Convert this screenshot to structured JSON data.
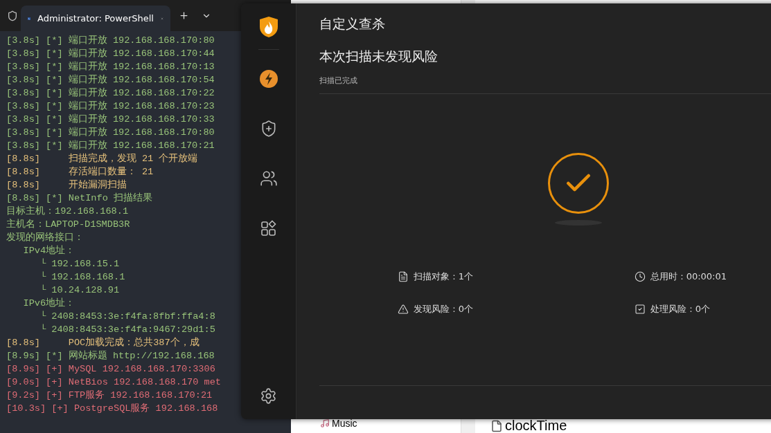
{
  "terminal": {
    "tab_title": "Administrator: PowerShell",
    "lines": [
      {
        "kind": "info",
        "text": "[3.8s] [*] 端口开放 192.168.168.170:80"
      },
      {
        "kind": "info",
        "text": "[3.8s] [*] 端口开放 192.168.168.170:44"
      },
      {
        "kind": "info",
        "text": "[3.8s] [*] 端口开放 192.168.168.170:13"
      },
      {
        "kind": "info",
        "text": "[3.8s] [*] 端口开放 192.168.168.170:54"
      },
      {
        "kind": "info",
        "text": "[3.8s] [*] 端口开放 192.168.168.170:22"
      },
      {
        "kind": "info",
        "text": "[3.8s] [*] 端口开放 192.168.168.170:23"
      },
      {
        "kind": "info",
        "text": "[3.8s] [*] 端口开放 192.168.168.170:33"
      },
      {
        "kind": "info",
        "text": "[3.8s] [*] 端口开放 192.168.168.170:80"
      },
      {
        "kind": "info",
        "text": "[3.8s] [*] 端口开放 192.168.168.170:21"
      },
      {
        "kind": "status",
        "text": "[8.8s]     扫描完成，发现 21 个开放端"
      },
      {
        "kind": "status",
        "text": "[8.8s]     存活端口数量： 21"
      },
      {
        "kind": "status",
        "text": "[8.8s]     开始漏洞扫描"
      },
      {
        "kind": "info",
        "text": "[8.8s] [*] NetInfo 扫描结果"
      },
      {
        "kind": "info",
        "text": "目标主机：192.168.168.1"
      },
      {
        "kind": "info",
        "text": "主机名：LAPTOP-D1SMDB3R"
      },
      {
        "kind": "info",
        "text": "发现的网络接口："
      },
      {
        "kind": "info",
        "text": "   IPv4地址："
      },
      {
        "kind": "info",
        "text": "      └ 192.168.15.1"
      },
      {
        "kind": "info",
        "text": "      └ 192.168.168.1"
      },
      {
        "kind": "info",
        "text": "      └ 10.24.128.91"
      },
      {
        "kind": "info",
        "text": "   IPv6地址："
      },
      {
        "kind": "info",
        "text": "      └ 2408:8453:3e:f4fa:8fbf:ffa4:8"
      },
      {
        "kind": "info",
        "text": "      └ 2408:8453:3e:f4fa:9467:29d1:5"
      },
      {
        "kind": "status",
        "text": "[8.8s]     POC加载完成：总共387个，成"
      },
      {
        "kind": "info",
        "text": "[8.9s] [*] 网站标题 http://192.168.168"
      },
      {
        "kind": "found",
        "text": "[8.9s] [+] MySQL 192.168.168.170:3306"
      },
      {
        "kind": "found",
        "text": "[9.0s] [+] NetBios 192.168.168.170 met"
      },
      {
        "kind": "found",
        "text": "[9.2s] [+] FTP服务 192.168.168.170:21"
      },
      {
        "kind": "found",
        "text": "[10.3s] [+] PostgreSQL服务 192.168.168"
      }
    ]
  },
  "security_app": {
    "title": "自定义查杀",
    "result_heading": "本次扫描未发现风险",
    "status": "扫描已完成",
    "stats": [
      {
        "text": "扫描对象 : 1个"
      },
      {
        "text": "总用时 : 00:00:01"
      },
      {
        "text": "发现风险 : 0个"
      },
      {
        "text": "处理风险 : 0个"
      }
    ]
  },
  "background_window": {
    "items": [
      {
        "text": "Music"
      },
      {
        "text": "clockTime"
      }
    ]
  }
}
